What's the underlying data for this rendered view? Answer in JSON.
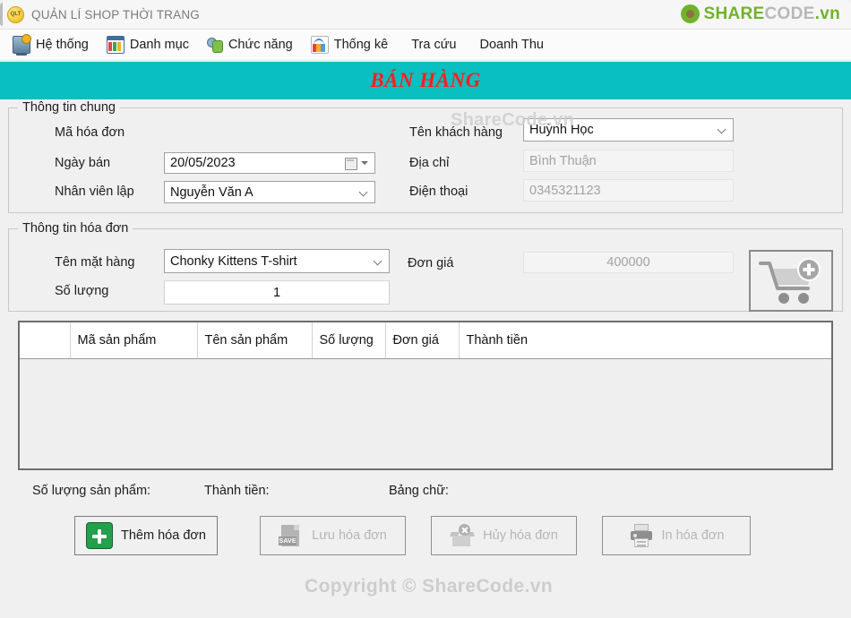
{
  "window": {
    "title": "QUẢN LÍ SHOP THỜI TRANG",
    "app_icon": "app-logo-icon",
    "brand": {
      "share": "SHARE",
      "code": "CODE",
      "vn": ".vn"
    }
  },
  "menubar": {
    "items": [
      {
        "label": "Hệ thống",
        "icon": "system-icon"
      },
      {
        "label": "Danh mục",
        "icon": "catalog-icon"
      },
      {
        "label": "Chức năng",
        "icon": "functions-icon"
      },
      {
        "label": "Thống kê",
        "icon": "statistics-icon"
      },
      {
        "label": "Tra cứu",
        "icon": ""
      },
      {
        "label": "Doanh Thu",
        "icon": ""
      }
    ]
  },
  "banner": {
    "title": "BÁN HÀNG",
    "background": "#09bfbf",
    "text_color": "#ff1f1f"
  },
  "general_info": {
    "legend": "Thông tin chung",
    "invoice_code": {
      "label": "Mã hóa đơn",
      "value": ""
    },
    "sale_date": {
      "label": "Ngày bán",
      "value": "20/05/2023"
    },
    "staff": {
      "label": "Nhân viên lập",
      "value": "Nguyễn Văn A"
    },
    "customer_name": {
      "label": "Tên khách hàng",
      "value": "Huỳnh Học"
    },
    "address": {
      "label": "Địa chỉ",
      "value": "Bình Thuận"
    },
    "phone": {
      "label": "Điện thoại",
      "value": "0345321123"
    }
  },
  "invoice_info": {
    "legend": "Thông tin hóa đơn",
    "item_name": {
      "label": "Tên mặt hàng",
      "value": "Chonky Kittens T-shirt"
    },
    "quantity": {
      "label": "Số lượng",
      "value": "1"
    },
    "unit_price": {
      "label": "Đơn giá",
      "value": "400000"
    },
    "add_to_cart_icon": "cart-add-icon"
  },
  "grid": {
    "columns": [
      "",
      "Mã sản phẩm",
      "Tên sản phẩm",
      "Số lượng",
      "Đơn giá",
      "Thành tiền"
    ],
    "rows": []
  },
  "totals": {
    "quantity_label": "Số lượng sản phẩm:",
    "quantity_value": "",
    "amount_label": "Thành tiền:",
    "amount_value": "",
    "words_label": "Bảng chữ:",
    "words_value": ""
  },
  "actions": [
    {
      "label": "Thêm hóa đơn",
      "icon": "add-icon",
      "enabled": true
    },
    {
      "label": "Lưu hóa đơn",
      "icon": "save-icon",
      "enabled": false,
      "icon_text": "SAVE"
    },
    {
      "label": "Hủy hóa đơn",
      "icon": "cancel-icon",
      "enabled": false
    },
    {
      "label": "In hóa đơn",
      "icon": "print-icon",
      "enabled": false
    }
  ],
  "watermarks": {
    "top": "ShareCode.vn",
    "bottom": "Copyright © ShareCode.vn"
  }
}
